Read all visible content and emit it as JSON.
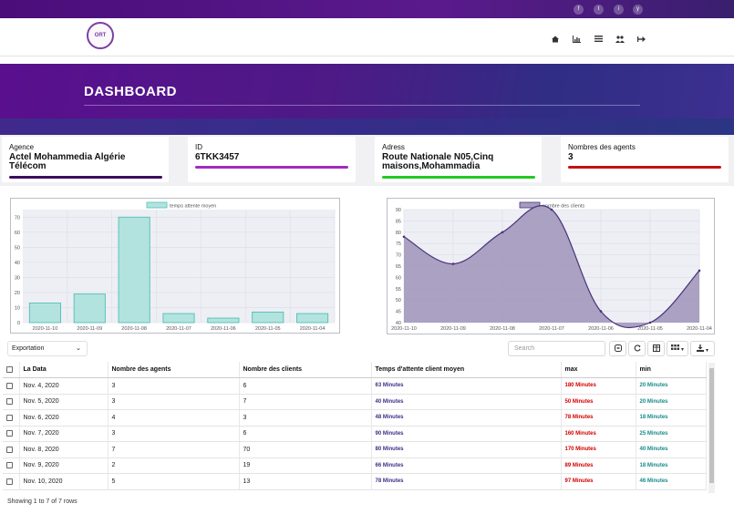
{
  "header": {
    "social": [
      "f",
      "t",
      "i",
      "y"
    ],
    "logo_text": "ORT",
    "nav_icons": [
      "home-icon",
      "chart-icon",
      "list-icon",
      "users-icon",
      "logout-icon"
    ]
  },
  "hero": {
    "title": "DASHBOARD"
  },
  "cards": [
    {
      "label": "Agence",
      "value": "Actel Mohammedia Algérie Télécom",
      "color": "#3a0c5e"
    },
    {
      "label": "ID",
      "value": "6TKK3457",
      "color": "#a32bbf"
    },
    {
      "label": "Adress",
      "value": "Route Nationale N05,Cinq maisons,Mohammadia",
      "color": "#22c922"
    },
    {
      "label": "Nombres des agents",
      "value": "3",
      "color": "#c41010"
    }
  ],
  "chart_data": [
    {
      "type": "bar",
      "legend": "temps attente moyen",
      "categories": [
        "2020-11-10",
        "2020-11-09",
        "2020-11-08",
        "2020-11-07",
        "2020-11-06",
        "2020-11-05",
        "2020-11-04"
      ],
      "values": [
        13,
        19,
        70,
        6,
        3,
        7,
        6
      ],
      "ylim": [
        0,
        75
      ],
      "yticks": [
        0,
        10,
        20,
        30,
        40,
        50,
        60,
        70
      ],
      "grid": true,
      "colors": {
        "fill": "#b3e3df",
        "stroke": "#4ec1b4"
      }
    },
    {
      "type": "area",
      "legend": "nombre des clients",
      "categories": [
        "2020-11-10",
        "2020-11-09",
        "2020-11-08",
        "2020-11-07",
        "2020-11-06",
        "2020-11-05",
        "2020-11-04"
      ],
      "values": [
        78,
        66,
        80,
        90,
        45,
        40,
        63
      ],
      "ylim": [
        40,
        90
      ],
      "yticks": [
        40,
        45,
        50,
        55,
        60,
        65,
        70,
        75,
        80,
        85,
        90
      ],
      "grid": true,
      "colors": {
        "fill": "#a59cc0",
        "stroke": "#4a3378"
      }
    }
  ],
  "toolbar": {
    "export_label": "Exportation",
    "search_placeholder": "Search"
  },
  "table": {
    "headers": [
      "La Data",
      "Nombre des agents",
      "Nombre des clients",
      "Temps d'attente client moyen",
      "max",
      "min"
    ],
    "rows": [
      [
        "Nov. 4, 2020",
        "3",
        "6",
        "63 Minutes",
        "180 Minutes",
        "20 Minutes"
      ],
      [
        "Nov. 5, 2020",
        "3",
        "7",
        "40 Minutes",
        "50 Minutes",
        "20 Minutes"
      ],
      [
        "Nov. 6, 2020",
        "4",
        "3",
        "48 Minutes",
        "78 Minutes",
        "18 Minutes"
      ],
      [
        "Nov. 7, 2020",
        "3",
        "6",
        "90 Minutes",
        "160 Minutes",
        "25 Minutes"
      ],
      [
        "Nov. 8, 2020",
        "7",
        "70",
        "80 Minutes",
        "170 Minutes",
        "40 Minutes"
      ],
      [
        "Nov. 9, 2020",
        "2",
        "19",
        "66 Minutes",
        "89 Minutes",
        "18 Minutes"
      ],
      [
        "Nov. 10, 2020",
        "5",
        "13",
        "78 Minutes",
        "97 Minutes",
        "46 Minutes"
      ]
    ]
  },
  "footer": {
    "showing": "Showing 1 to 7 of 7 rows"
  }
}
